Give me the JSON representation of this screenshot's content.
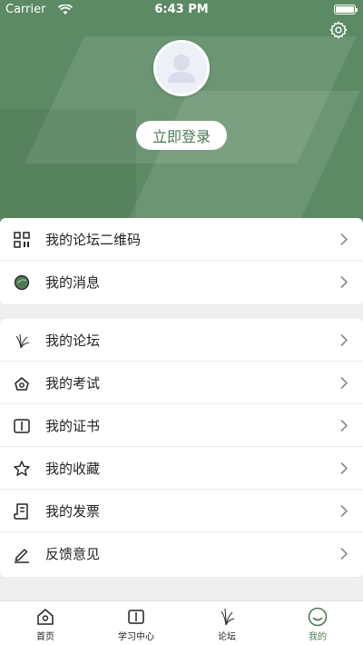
{
  "status_bar": {
    "carrier": "Carrier",
    "time": "6:43 PM"
  },
  "header": {
    "login_label": "立即登录"
  },
  "menu_group_1": [
    {
      "label": "我的论坛二维码",
      "icon": "qrcode-icon"
    },
    {
      "label": "我的消息",
      "icon": "message-icon"
    }
  ],
  "menu_group_2": [
    {
      "label": "我的论坛",
      "icon": "forum-icon"
    },
    {
      "label": "我的考试",
      "icon": "exam-icon"
    },
    {
      "label": "我的证书",
      "icon": "certificate-icon"
    },
    {
      "label": "我的收藏",
      "icon": "star-icon"
    },
    {
      "label": "我的发票",
      "icon": "invoice-icon"
    },
    {
      "label": "反馈意见",
      "icon": "feedback-icon"
    }
  ],
  "tabbar": [
    {
      "label": "首页",
      "icon": "home-icon"
    },
    {
      "label": "学习中心",
      "icon": "book-icon"
    },
    {
      "label": "论坛",
      "icon": "forum-icon"
    },
    {
      "label": "我的",
      "icon": "smile-icon",
      "active": true
    }
  ],
  "colors": {
    "brand": "#5b8a64",
    "accent_text": "#4c7a55"
  }
}
